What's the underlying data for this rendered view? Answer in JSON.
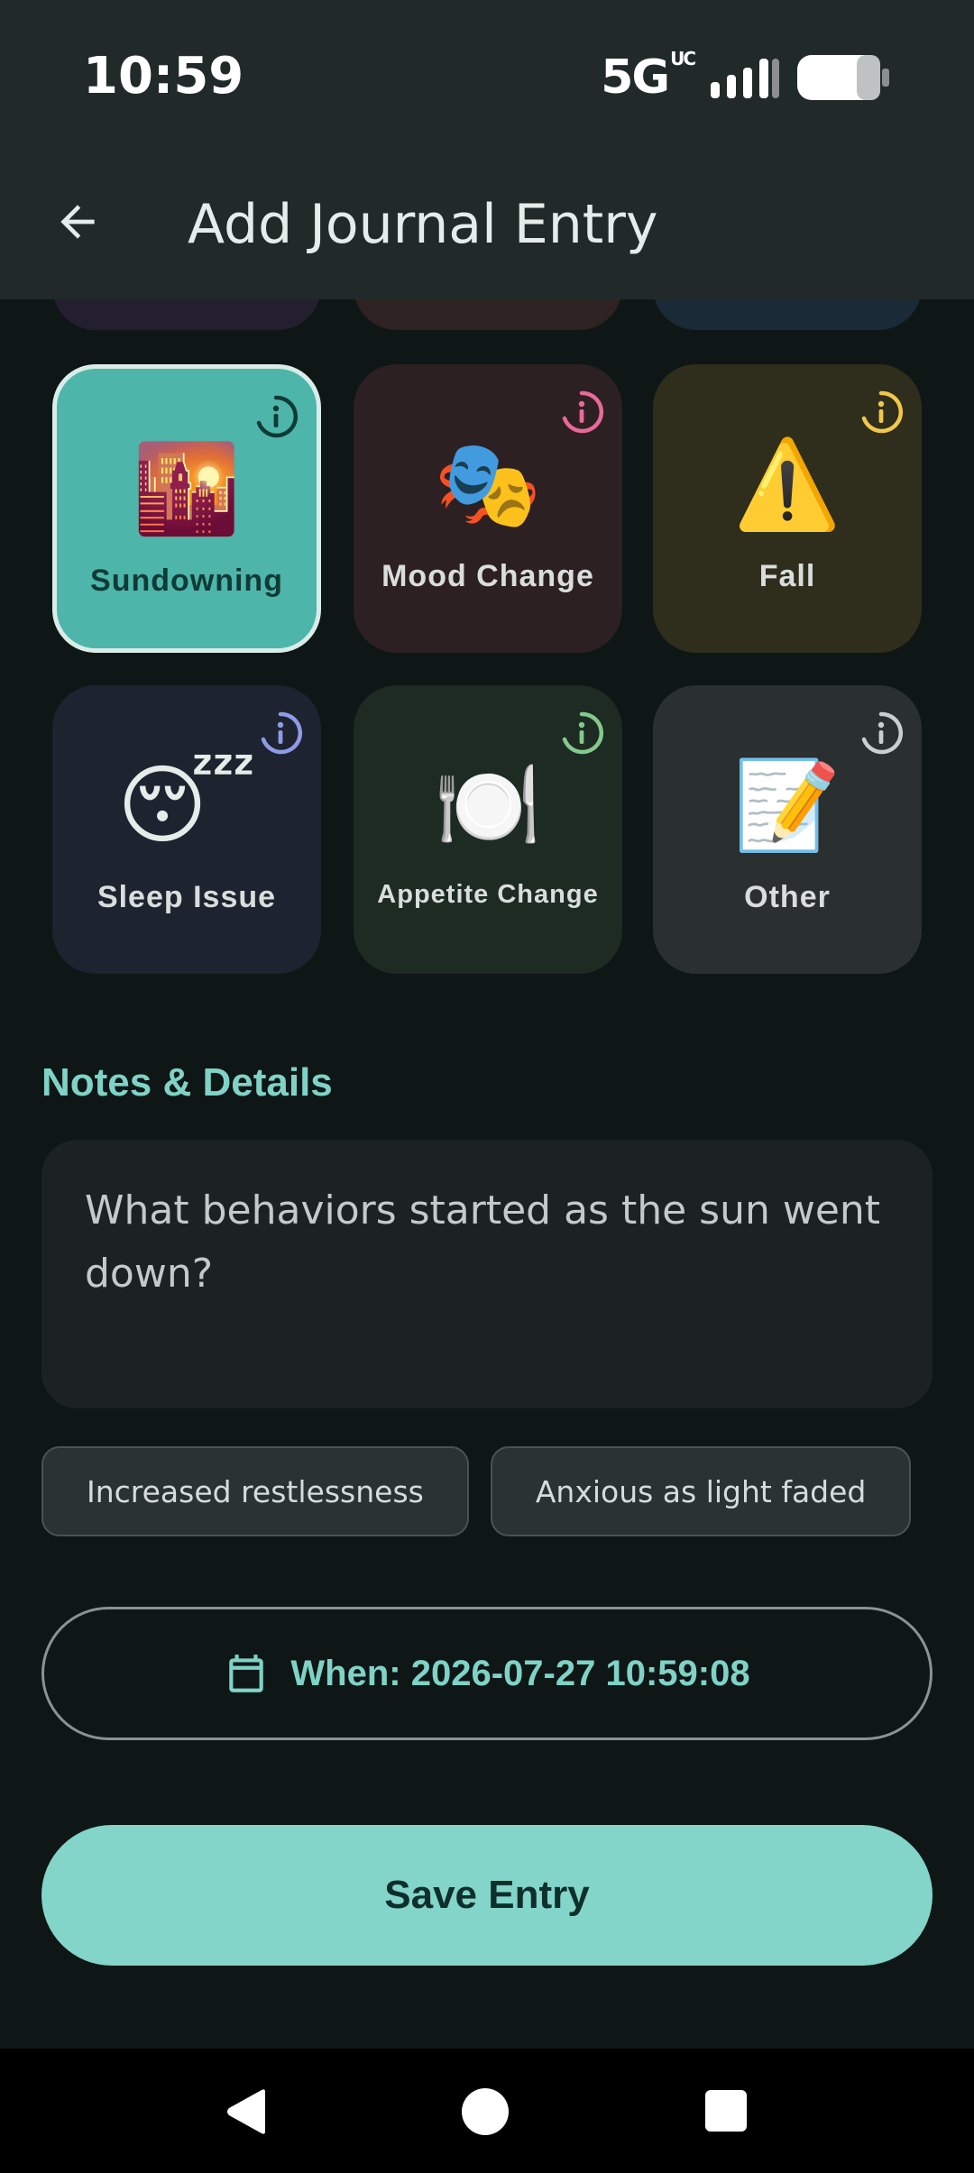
{
  "status_bar": {
    "time": "10:59",
    "network": "5G",
    "network_sup": "UC"
  },
  "app_bar": {
    "title": "Add Journal Entry",
    "back_icon": "arrow-left-icon"
  },
  "categories": [
    {
      "label": "Sundowning",
      "emoji": "🌇",
      "selected": true,
      "bg": "#4db5aa",
      "info_color": "#0f3a36"
    },
    {
      "label": "Mood Change",
      "emoji": "🎭",
      "selected": false,
      "bg": "#2d2022",
      "info_color": "#e8699a"
    },
    {
      "label": "Fall",
      "emoji": "⚠️",
      "selected": false,
      "bg": "#2f2d1c",
      "info_color": "#f1c74b"
    },
    {
      "label": "Sleep Issue",
      "emoji": "😴",
      "selected": false,
      "bg": "#1e2330",
      "info_color": "#8f9be6"
    },
    {
      "label": "Appetite Change",
      "emoji": "🍽️",
      "selected": false,
      "bg": "#1d2b22",
      "info_color": "#84c98c"
    },
    {
      "label": "Other",
      "emoji": "📝",
      "selected": false,
      "bg": "#2a2f2f",
      "info_color": "#c9cfce"
    }
  ],
  "notes": {
    "section_title": "Notes & Details",
    "placeholder": "What behaviors started as the sun went down?"
  },
  "suggestion_chips": [
    "Increased restlessness",
    "Anxious as light faded",
    ""
  ],
  "when_button": {
    "label": "When: 2026-07-27 10:59:08",
    "icon": "calendar-icon"
  },
  "save_button": {
    "label": "Save Entry"
  },
  "colors": {
    "accent": "#7fd3c6",
    "save_bg": "#82d5c8",
    "app_bar": "#212a29",
    "background": "#0f1616"
  }
}
